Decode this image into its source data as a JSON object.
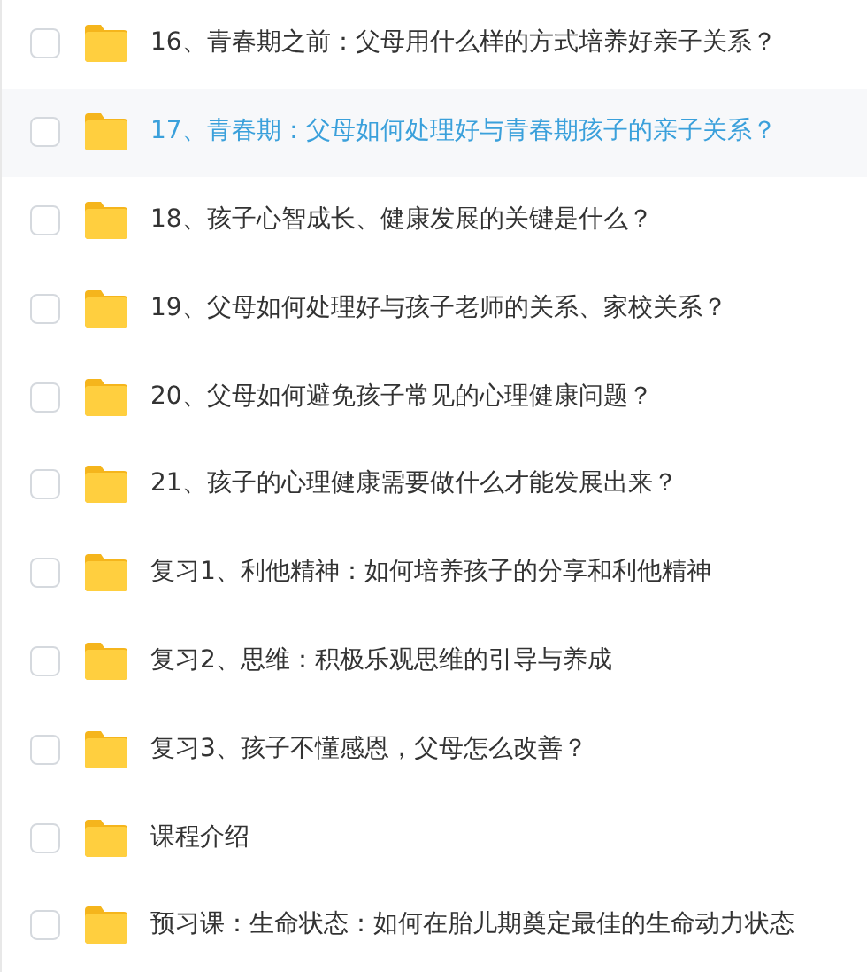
{
  "items": [
    {
      "title": "16、青春期之前：父母用什么样的方式培养好亲子关系？",
      "selected": false,
      "checked": false
    },
    {
      "title": "17、青春期：父母如何处理好与青春期孩子的亲子关系？",
      "selected": true,
      "checked": false
    },
    {
      "title": "18、孩子心智成长、健康发展的关键是什么？",
      "selected": false,
      "checked": false
    },
    {
      "title": "19、父母如何处理好与孩子老师的关系、家校关系？",
      "selected": false,
      "checked": false
    },
    {
      "title": "20、父母如何避免孩子常见的心理健康问题？",
      "selected": false,
      "checked": false
    },
    {
      "title": "21、孩子的心理健康需要做什么才能发展出来？",
      "selected": false,
      "checked": false
    },
    {
      "title": "复习1、利他精神：如何培养孩子的分享和利他精神",
      "selected": false,
      "checked": false
    },
    {
      "title": "复习2、思维：积极乐观思维的引导与养成",
      "selected": false,
      "checked": false
    },
    {
      "title": "复习3、孩子不懂感恩，父母怎么改善？",
      "selected": false,
      "checked": false
    },
    {
      "title": "课程介绍",
      "selected": false,
      "checked": false
    },
    {
      "title": "预习课：生命状态：如何在胎儿期奠定最佳的生命动力状态",
      "selected": false,
      "checked": false
    }
  ]
}
